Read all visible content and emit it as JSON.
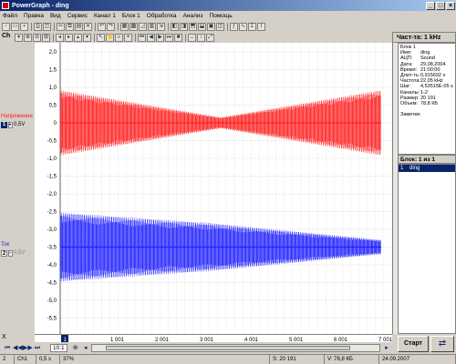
{
  "window": {
    "title": "PowerGraph - ding"
  },
  "menu": [
    "Файл",
    "Правка",
    "Вид",
    "Сервис",
    "Канал 1",
    "Блок 1",
    "Обработка",
    "Анализ",
    "Помощь"
  ],
  "toolbar": {
    "channel_label": "Ch",
    "freq_label": "Част-та: 1 kHz"
  },
  "channels": [
    {
      "name": "Напряжение",
      "number": "1",
      "value": "0,5V",
      "color": "#ff2020"
    },
    {
      "name": "Ток",
      "number": "2",
      "value": "0,5V",
      "color": "#2020ff"
    }
  ],
  "yaxis": {
    "ticks": [
      "2,0",
      "1,5",
      "1,0",
      "0,5",
      "0",
      "-0,5",
      "-1,0",
      "-1,5",
      "-2,0",
      "-2,5",
      "-3,0",
      "-3,5",
      "-4,0",
      "-4,5",
      "-5,0",
      "-5,5"
    ]
  },
  "xaxis": {
    "ticks": [
      "1",
      "1 001",
      "2 001",
      "3 001",
      "4 001",
      "5 001",
      "6 001",
      "7 001"
    ],
    "bottom_left": "X"
  },
  "info": {
    "header": "Блок 1",
    "rows": [
      {
        "key": "Имя:",
        "value": "ding"
      },
      {
        "key": "АЦП:",
        "value": "Sound"
      },
      {
        "key": "Дата:",
        "value": "29.08.2004"
      },
      {
        "key": "Время:",
        "value": "21:00:00"
      },
      {
        "key": "Длит-ть:",
        "value": "0,915692 s"
      },
      {
        "key": "Частота:",
        "value": "22,05 kHz"
      },
      {
        "key": "Шаг:",
        "value": "4,53515E-05 s"
      },
      {
        "key": "Каналы:",
        "value": "1-2"
      },
      {
        "key": "Размер:",
        "value": "20 191"
      },
      {
        "key": "Объем:",
        "value": "78,8 КБ"
      }
    ],
    "notes_label": "Заметки:"
  },
  "blocks": {
    "header": "Блок: 1 из 1",
    "items": [
      {
        "num": "1",
        "name": "ding"
      }
    ]
  },
  "nav": {
    "zoom_ratio": "10:1",
    "start_label": "Старт"
  },
  "status": {
    "channel_index": "2",
    "channel": "Ch1",
    "scale": "0,5 s",
    "percent": "37%",
    "samples": "S: 20 191",
    "volume": "V: 78,8 КБ",
    "date": "24.09.2007"
  },
  "colors": {
    "accent": "#0a246a",
    "red_signal": "#ff2020",
    "blue_signal": "#2020ff"
  }
}
